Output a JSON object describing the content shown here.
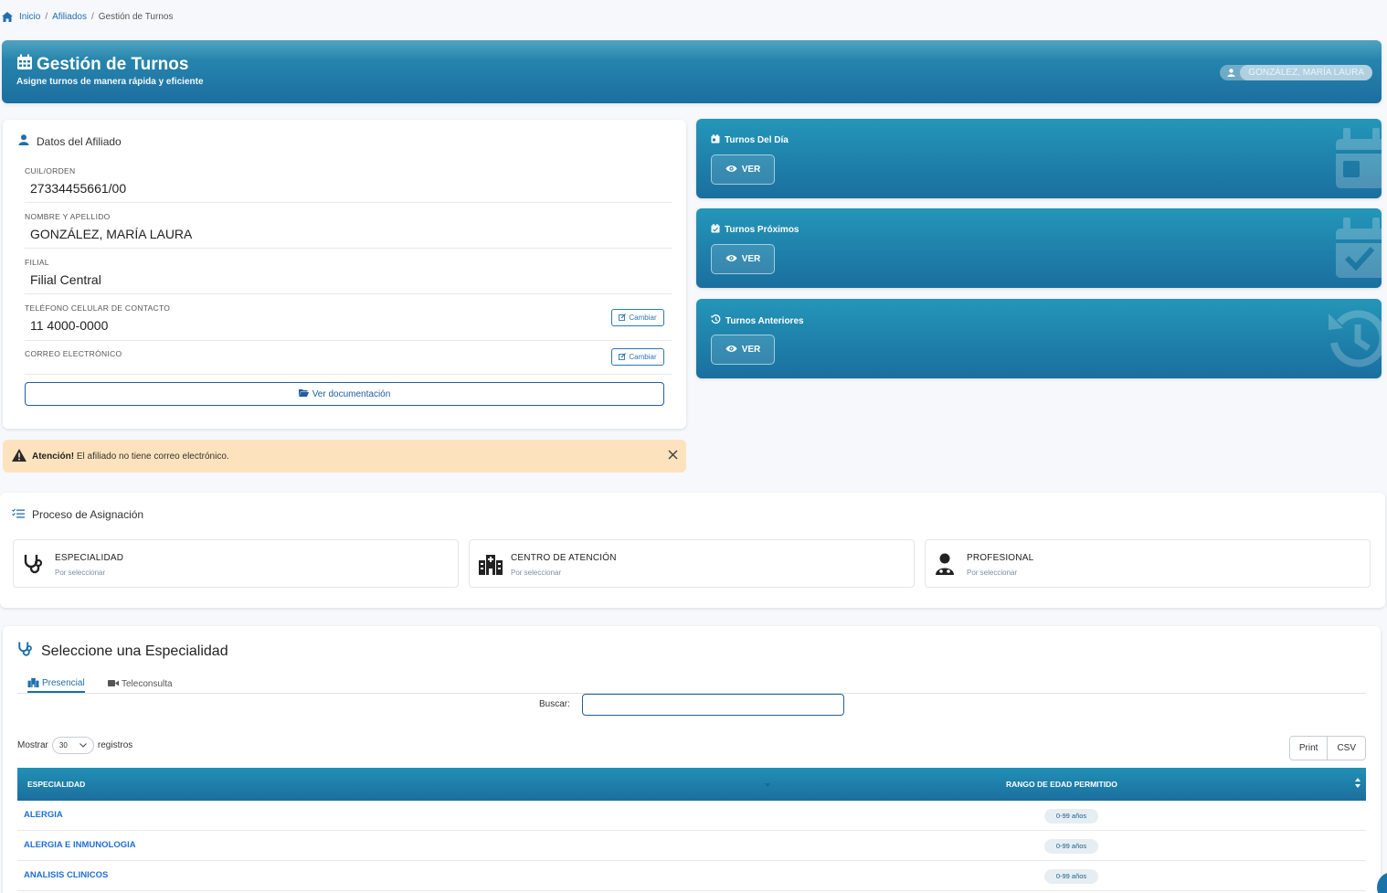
{
  "breadcrumb": {
    "home": "Inicio",
    "section": "Afiliados",
    "current": "Gestión de Turnos",
    "separator": "/"
  },
  "header": {
    "title": "Gestión de Turnos",
    "subtitle": "Asigne turnos de manera rápida y eficiente",
    "user_name": "GONZÁLEZ, MARÍA LAURA"
  },
  "affiliate": {
    "title": "Datos del Afiliado",
    "fields": [
      {
        "label": "CUIL/ORDEN",
        "value": "27334455661/00"
      },
      {
        "label": "NOMBRE Y APELLIDO",
        "value": "GONZÁLEZ, MARÍA LAURA"
      },
      {
        "label": "FILIAL",
        "value": "Filial Central"
      },
      {
        "label": "TELÉFONO CELULAR DE CONTACTO",
        "value": "11 4000-0000",
        "action": "Cambiar"
      },
      {
        "label": "CORREO ELECTRÓNICO",
        "value": "",
        "action": "Cambiar"
      }
    ],
    "doc_button": "Ver documentación"
  },
  "alert": {
    "strong": "Atención!",
    "text": "El afiliado no tiene correo electrónico.",
    "close": "×"
  },
  "turn_cards": [
    {
      "title": "Turnos Del Día",
      "button": "VER"
    },
    {
      "title": "Turnos Próximos",
      "button": "VER"
    },
    {
      "title": "Turnos Anteriores",
      "button": "VER"
    }
  ],
  "process": {
    "title": "Proceso de Asignación",
    "steps": [
      {
        "title": "ESPECIALIDAD",
        "status": "Por seleccionar"
      },
      {
        "title": "CENTRO DE ATENCIÓN",
        "status": "Por seleccionar"
      },
      {
        "title": "PROFESIONAL",
        "status": "Por seleccionar"
      }
    ]
  },
  "specialty": {
    "title": "Seleccione una Especialidad",
    "tabs": [
      {
        "label": "Presencial",
        "active": true
      },
      {
        "label": "Teleconsulta",
        "active": false
      }
    ],
    "search_label": "Buscar:",
    "search_value": "",
    "show_prefix": "Mostrar",
    "show_value": "30",
    "show_suffix": "registros",
    "buttons": {
      "print": "Print",
      "csv": "CSV"
    },
    "columns": [
      "ESPECIALIDAD",
      "RANGO DE EDAD PERMITIDO"
    ],
    "rows": [
      {
        "name": "ALERGIA",
        "range": "0-99 años"
      },
      {
        "name": "ALERGIA E INMUNOLOGIA",
        "range": "0-99 años"
      },
      {
        "name": "ANALISIS CLINICOS",
        "range": "0-99 años"
      }
    ]
  },
  "colors": {
    "primary": "#1d6fa8",
    "header_gradient_top": "#2a8fb3",
    "header_gradient_bottom": "#1c6ea0",
    "alert_bg": "#fde3bd",
    "link": "#1f6fd0"
  }
}
